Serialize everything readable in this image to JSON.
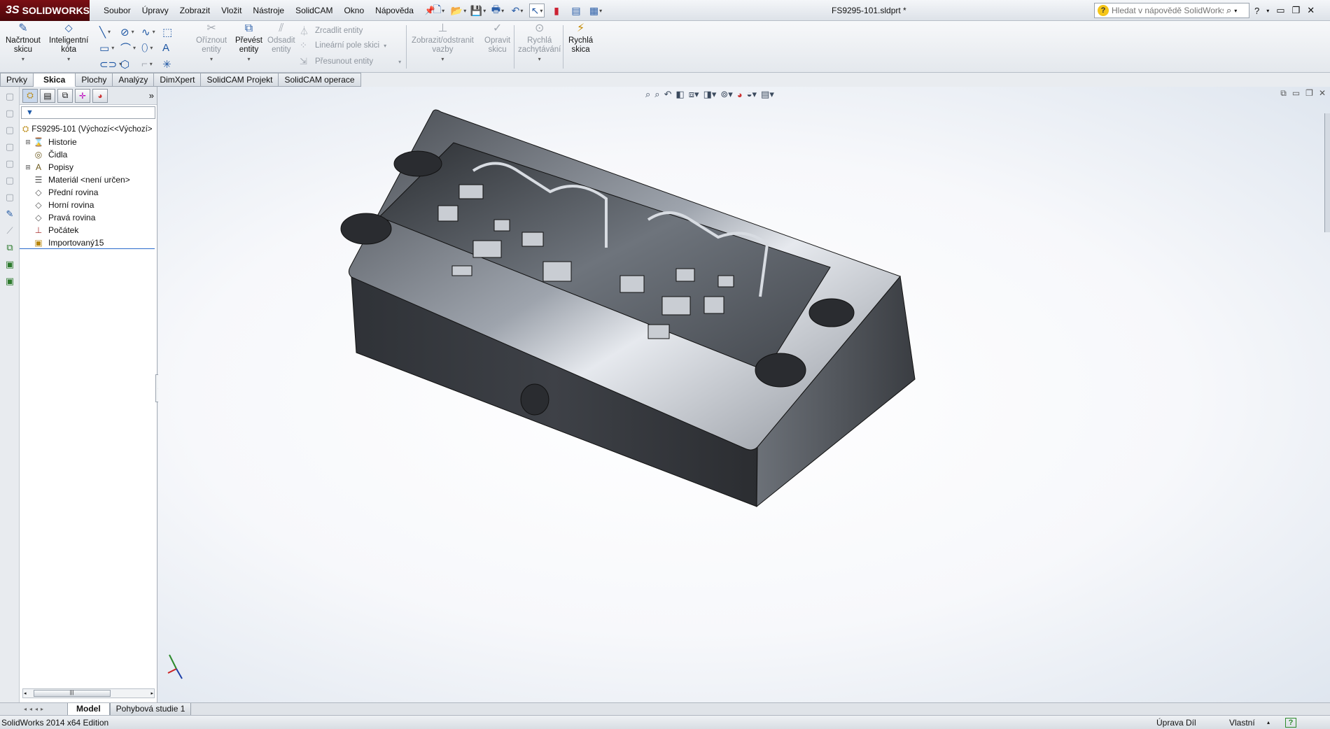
{
  "app": {
    "brand": "SOLIDWORKS",
    "brand_prefix": "3S",
    "document_title": "FS9295-101.sldprt *"
  },
  "menu": [
    "Soubor",
    "Úpravy",
    "Zobrazit",
    "Vložit",
    "Nástroje",
    "SolidCAM",
    "Okno",
    "Nápověda"
  ],
  "help_search": {
    "placeholder": "Hledat v nápovědě SolidWorks"
  },
  "command_manager": {
    "sketch": "Načrtnout\nskicu",
    "smart_dimension": "Inteligentní\nkóta",
    "trim": "Oříznout\nentity",
    "convert": "Převést\nentity",
    "offset": "Odsadit\nentity",
    "mirror": "Zrcadlit entity",
    "linear_pattern": "Lineární pole skici",
    "move": "Přesunout entity",
    "relations": "Zobrazit/odstranit\nvazby",
    "repair": "Opravit\nskicu",
    "quick_snaps": "Rychlá\nzachytávání",
    "rapid_sketch": "Rychlá\nskica"
  },
  "tabs": [
    {
      "label": "Prvky",
      "active": false
    },
    {
      "label": "Skica",
      "active": true
    },
    {
      "label": "Plochy",
      "active": false
    },
    {
      "label": "Analýzy",
      "active": false
    },
    {
      "label": "DimXpert",
      "active": false
    },
    {
      "label": "SolidCAM Projekt",
      "active": false
    },
    {
      "label": "SolidCAM operace",
      "active": false
    }
  ],
  "feature_tree": {
    "root": "FS9295-101  (Výchozí<<Výchozí>",
    "items": [
      {
        "label": "Historie",
        "expandable": true,
        "icon": "history-icon"
      },
      {
        "label": "Čidla",
        "expandable": false,
        "icon": "sensors-icon"
      },
      {
        "label": "Popisy",
        "expandable": true,
        "icon": "annotations-icon"
      },
      {
        "label": "Materiál <není určen>",
        "expandable": false,
        "icon": "material-icon"
      },
      {
        "label": "Přední rovina",
        "expandable": false,
        "icon": "plane-icon"
      },
      {
        "label": "Horní rovina",
        "expandable": false,
        "icon": "plane-icon"
      },
      {
        "label": "Pravá rovina",
        "expandable": false,
        "icon": "plane-icon"
      },
      {
        "label": "Počátek",
        "expandable": false,
        "icon": "origin-icon"
      },
      {
        "label": "Importovaný15",
        "expandable": false,
        "icon": "imported-body-icon"
      }
    ]
  },
  "bottom_tabs": [
    {
      "label": "Model",
      "active": true
    },
    {
      "label": "Pohybová studie 1",
      "active": false
    }
  ],
  "status": {
    "edition": "SolidWorks 2014 x64 Edition",
    "mode": "Úprava Díl",
    "units": "Vlastní"
  },
  "colors": {
    "brand": "#6b0c11",
    "model_dark": "#3a3d42",
    "model_light": "#c8ccd2"
  }
}
